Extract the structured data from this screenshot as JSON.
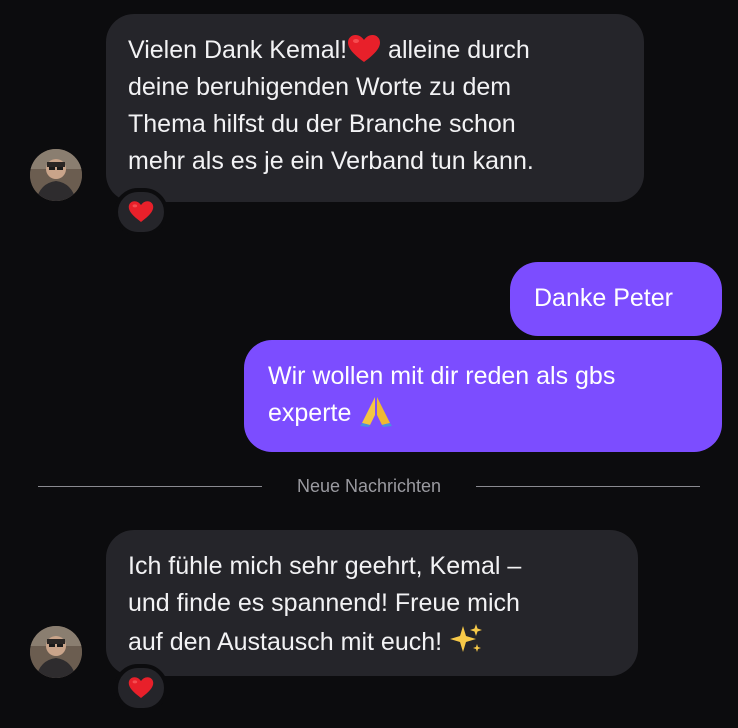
{
  "messages": [
    {
      "direction": "incoming",
      "text_before": "Vielen Dank Kemal!",
      "text_after": " alleine durch\ndeine beruhigenden Worte zu dem\nThema hilfst du der Branche schon\nmehr als es je ein Verband tun kann.",
      "inline_emoji": "red-heart-icon",
      "reaction": "red-heart-icon"
    },
    {
      "direction": "outgoing",
      "text": "Danke Peter"
    },
    {
      "direction": "outgoing",
      "text_before": "Wir wollen mit dir reden als gbs\nexperte ",
      "inline_emoji": "folded-hands-icon"
    },
    {
      "direction": "incoming",
      "text_before": "Ich fühle mich sehr geehrt, Kemal –\nund finde es spannend! Freue mich\nauf den Austausch mit euch! ",
      "inline_emoji": "sparkles-icon",
      "reaction": "red-heart-icon"
    }
  ],
  "divider": {
    "label": "Neue Nachrichten"
  },
  "colors": {
    "background": "#0c0c0e",
    "incoming_bubble": "#25252a",
    "outgoing_bubble": "#7c4dff",
    "heart": "#e8202a"
  }
}
